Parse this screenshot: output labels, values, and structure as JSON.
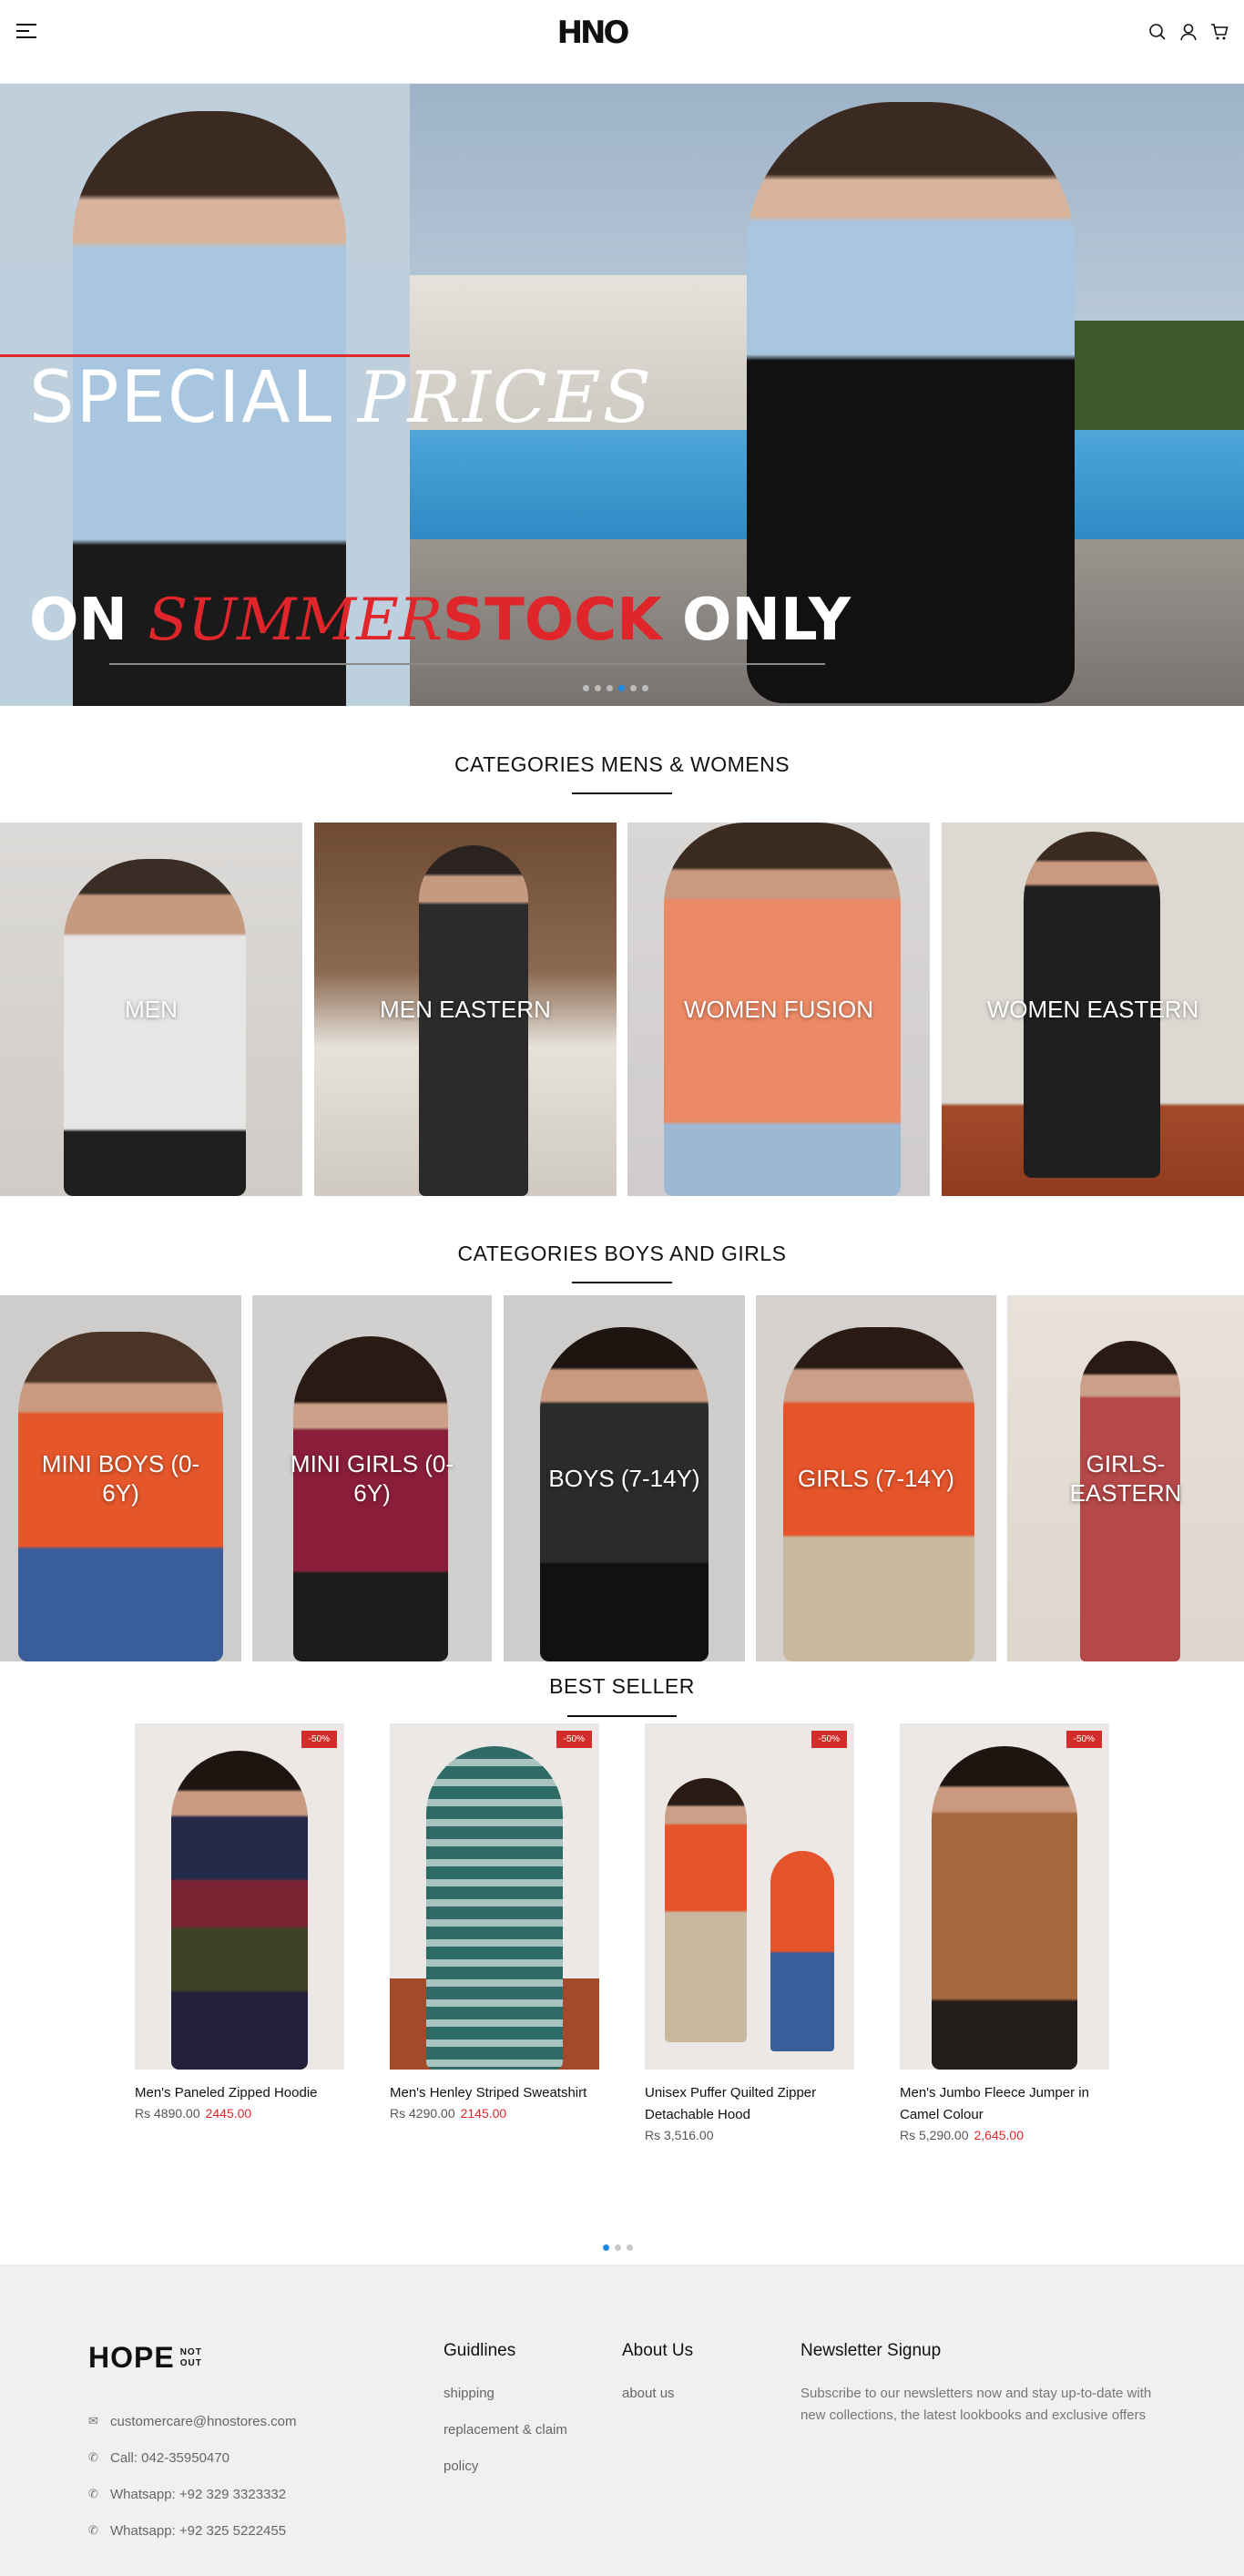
{
  "header": {
    "logo": "HNO",
    "icons": [
      "menu-icon",
      "search-icon",
      "user-icon",
      "cart-icon"
    ]
  },
  "hero": {
    "title_line1_a": "SPECIAL",
    "title_line1_b": "PRICES",
    "title_line2_a": "ON",
    "title_line2_b": "SUMMER",
    "title_line2_c": "STOCK",
    "title_line2_d": "ONLY",
    "slide_count": 6,
    "active_slide": 4
  },
  "categories_mw": {
    "title": "CATEGORIES MENS & WOMENS",
    "items": [
      {
        "label": "MEN"
      },
      {
        "label": "MEN EASTERN"
      },
      {
        "label": "WOMEN FUSION"
      },
      {
        "label": "WOMEN EASTERN"
      }
    ]
  },
  "categories_bg": {
    "title": "CATEGORIES BOYS AND GIRLS",
    "items": [
      {
        "label": "MINI BOYS (0-6Y)"
      },
      {
        "label": "MINI GIRLS (0-6Y)"
      },
      {
        "label": "BOYS (7-14Y)"
      },
      {
        "label": "GIRLS (7-14Y)"
      },
      {
        "label": "GIRLS-EASTERN"
      }
    ]
  },
  "best_seller": {
    "title": "BEST SELLER",
    "products": [
      {
        "name": "Men's Paneled Zipped Hoodie",
        "badge": "-50%",
        "price": "Rs 4890.00",
        "sale_price": "2445.00"
      },
      {
        "name": "Men's Henley Striped Sweatshirt",
        "badge": "-50%",
        "price": "Rs 4290.00",
        "sale_price": "2145.00"
      },
      {
        "name": "Unisex Puffer Quilted Zipper Detachable Hood",
        "badge": "-50%",
        "price": "Rs 3,516.00",
        "sale_price": ""
      },
      {
        "name": "Men's Jumbo Fleece Jumper in Camel Colour",
        "badge": "-50%",
        "price": "Rs 5,290.00",
        "sale_price": "2,645.00"
      }
    ],
    "page_count": 3,
    "active_page": 1
  },
  "footer": {
    "logo_big": "HOPE",
    "logo_small_1": "NOT",
    "logo_small_2": "OUT",
    "contact": {
      "email": "customercare@hnostores.com",
      "call": "Call: 042-35950470",
      "whatsapp1": "Whatsapp: +92 329 3323332",
      "whatsapp2": "Whatsapp: +92 325 5222455"
    },
    "guidelines": {
      "title": "Guidlines",
      "links": [
        "shipping",
        "replacement & claim",
        "policy"
      ]
    },
    "about": {
      "title": "About Us",
      "links": [
        "about us"
      ]
    },
    "newsletter": {
      "title": "Newsletter Signup",
      "text": "Subscribe to our newsletters now and stay up-to-date with new collections, the latest lookbooks and exclusive offers"
    }
  }
}
